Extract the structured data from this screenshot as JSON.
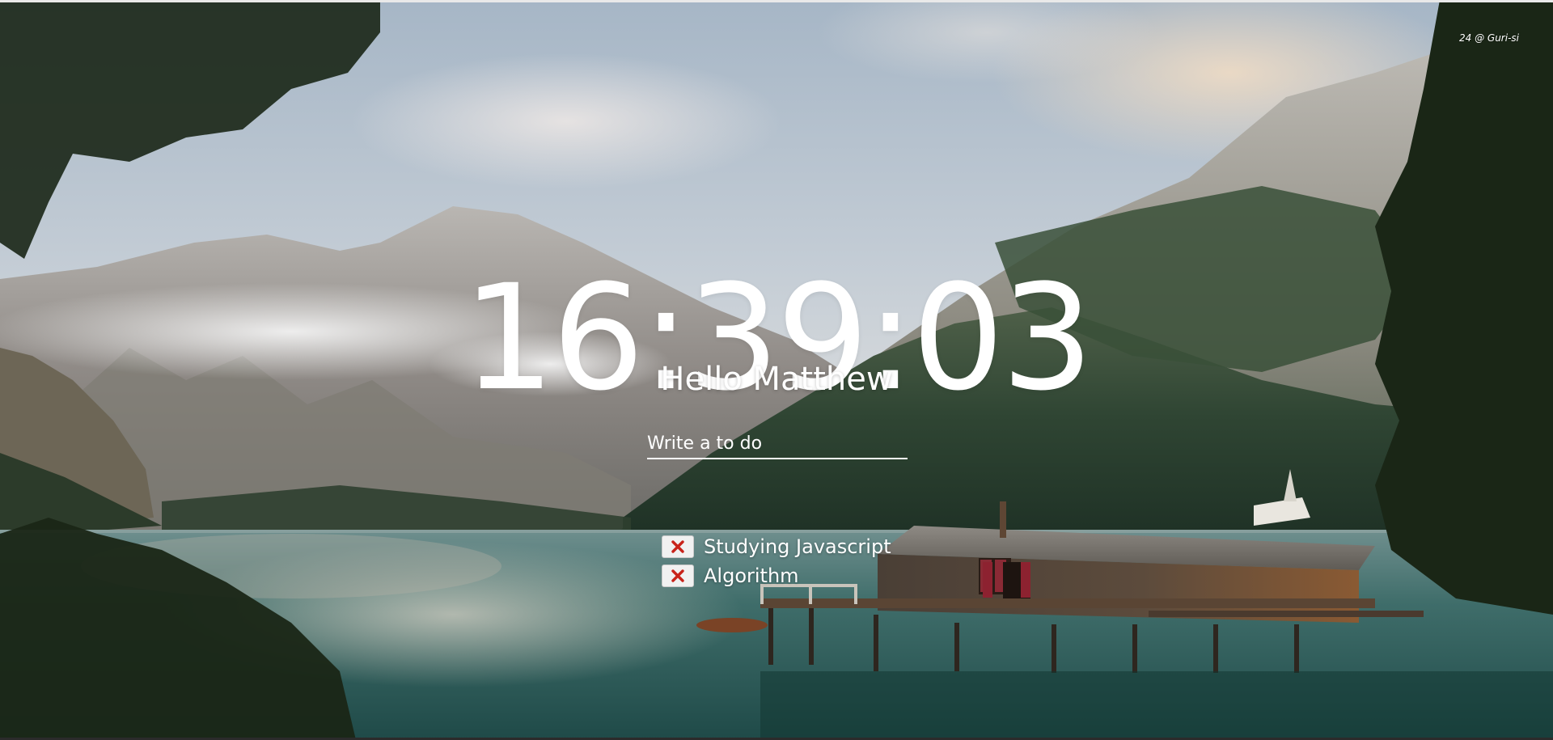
{
  "credit": "24 @ Guri-si",
  "clock": "16:39:03",
  "greeting": "Hello Matthew",
  "todo": {
    "placeholder": "Write a to do",
    "items": [
      {
        "text": "Studying Javascript",
        "delete_icon": "x-icon"
      },
      {
        "text": "Algorithm",
        "delete_icon": "x-icon"
      }
    ]
  },
  "colors": {
    "text": "#ffffff",
    "delete_x": "#c8231a"
  }
}
